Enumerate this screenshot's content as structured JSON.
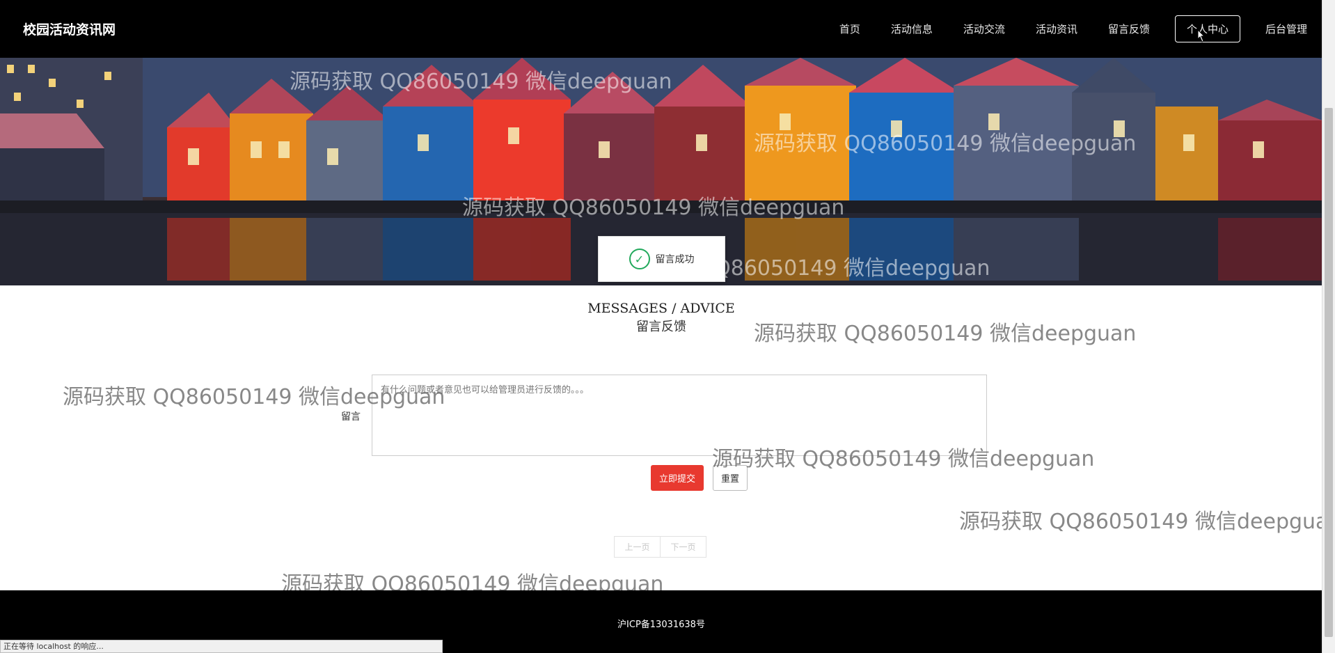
{
  "header": {
    "brand": "校园活动资讯网",
    "nav": [
      "首页",
      "活动信息",
      "活动交流",
      "活动资讯",
      "留言反馈",
      "个人中心",
      "后台管理"
    ],
    "active_index": 5
  },
  "toast": {
    "text": "留言成功"
  },
  "section": {
    "title_en": "MESSAGES / ADVICE",
    "title_cn": "留言反馈"
  },
  "form": {
    "label": "留言",
    "placeholder": "有什么问题或者意见也可以给管理员进行反馈的。。。",
    "submit": "立即提交",
    "reset": "重置"
  },
  "pager": {
    "prev": "上一页",
    "next": "下一页"
  },
  "footer": {
    "icp": "沪ICP备13031638号"
  },
  "status_bar": "正在等待 localhost 的响应...",
  "watermark": "源码获取 QQ86050149 微信deepguan",
  "colors": {
    "accent": "#e8392f",
    "header_bg": "#000000",
    "success": "#22a95c"
  }
}
